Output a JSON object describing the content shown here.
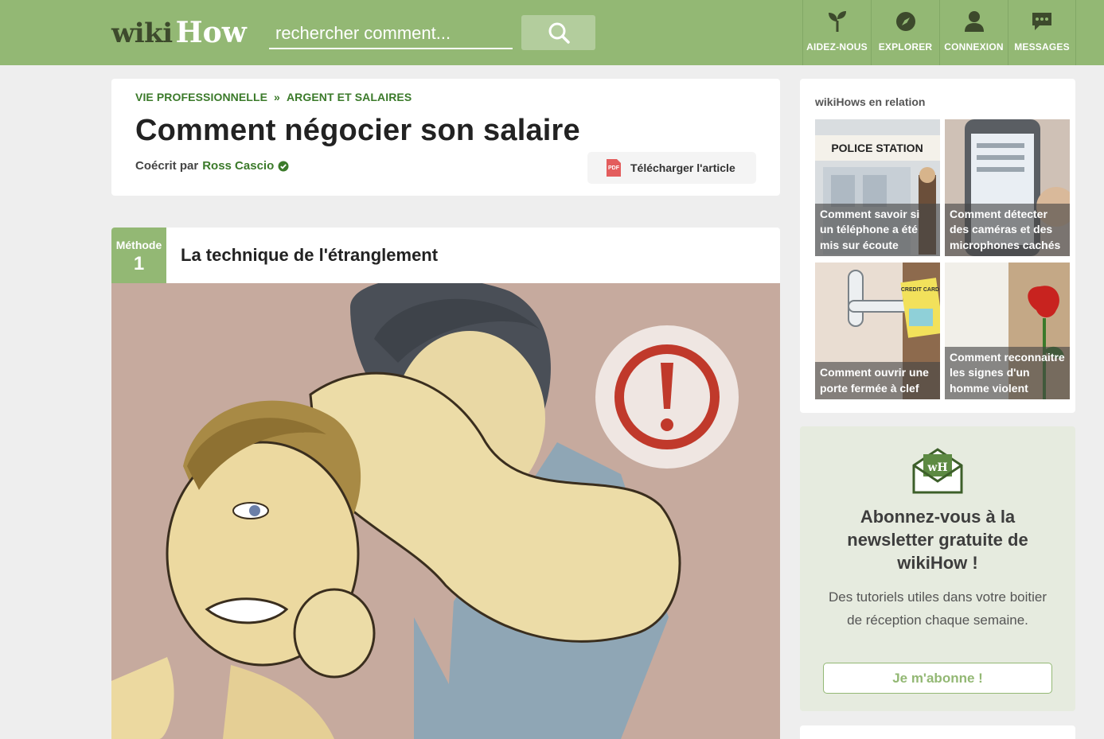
{
  "header": {
    "logo_wiki": "wiki",
    "logo_how": "How",
    "search_placeholder": "rechercher comment...",
    "nav": [
      {
        "label": "AIDEZ-NOUS",
        "icon": "sprout-icon"
      },
      {
        "label": "EXPLORER",
        "icon": "compass-icon"
      },
      {
        "label": "CONNEXION",
        "icon": "user-icon"
      },
      {
        "label": "MESSAGES",
        "icon": "chat-bubble-icon"
      }
    ]
  },
  "article": {
    "breadcrumbs": [
      "VIE PROFESSIONNELLE",
      "ARGENT ET SALAIRES"
    ],
    "breadcrumb_separator": "»",
    "title": "Comment négocier son salaire",
    "byline_prefix": "Coécrit par",
    "author": "Ross Cascio",
    "download_label": "Télécharger l'article",
    "download_icon_text": "PDF"
  },
  "method": {
    "label": "Méthode",
    "number": "1",
    "title": "La technique de l'étranglement"
  },
  "related": {
    "heading": "wikiHows en relation",
    "items": [
      {
        "caption": "Comment savoir si un téléphone a été mis sur écoute",
        "image_text": "POLICE STATION"
      },
      {
        "caption": "Comment détecter des caméras et des microphones cachés"
      },
      {
        "caption": "Comment ouvrir une porte fermée à clef",
        "image_text": "CREDIT CARD"
      },
      {
        "caption": "Comment reconnaitre les signes d'un homme violent"
      }
    ]
  },
  "newsletter": {
    "icon_text": "wH",
    "title": "Abonnez-vous à la newsletter gratuite de wikiHow !",
    "description": "Des tutoriels utiles dans votre boitier de réception chaque semaine.",
    "button": "Je m'abonne !"
  },
  "colors": {
    "brand_green": "#93b874",
    "link_green": "#3b7a2a",
    "alert_red": "#c0392b"
  }
}
